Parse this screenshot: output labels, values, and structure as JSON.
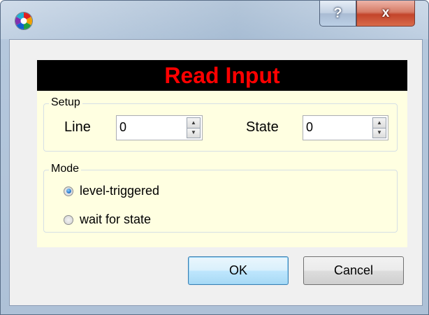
{
  "window": {
    "icon": "app-logo-icon",
    "help_label": "?",
    "close_label": "x"
  },
  "banner": {
    "title": "Read Input",
    "title_color": "#ff0000",
    "background": "#000000"
  },
  "panel_background": "#ffffe1",
  "setup": {
    "group_label": "Setup",
    "line_label": "Line",
    "line_value": "0",
    "state_label": "State",
    "state_value": "0"
  },
  "mode": {
    "group_label": "Mode",
    "options": [
      {
        "label": "level-triggered",
        "checked": true
      },
      {
        "label": "wait for state",
        "checked": false
      }
    ]
  },
  "buttons": {
    "ok_label": "OK",
    "cancel_label": "Cancel"
  }
}
